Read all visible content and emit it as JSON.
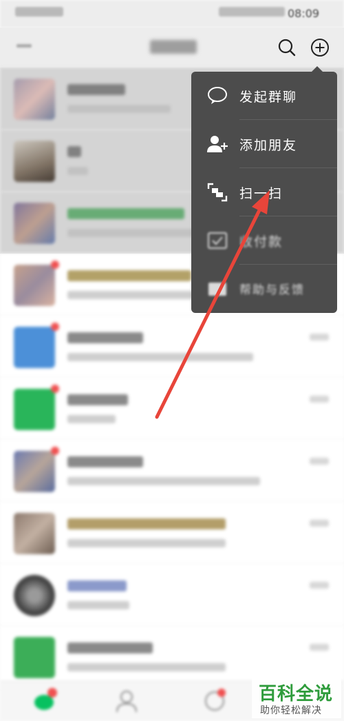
{
  "status_bar": {
    "time": "08:09"
  },
  "popup_menu": {
    "items": [
      {
        "label": "发起群聊",
        "icon": "chat-bubble-icon"
      },
      {
        "label": "添加朋友",
        "icon": "add-friend-icon"
      },
      {
        "label": "扫一扫",
        "icon": "scan-icon"
      },
      {
        "label": "收付款",
        "icon": "payment-icon"
      },
      {
        "label": "帮助与反馈",
        "icon": "help-feedback-icon"
      }
    ]
  },
  "watermark": {
    "title": "百科全说",
    "subtitle": "助你轻松解决"
  },
  "colors": {
    "popup_bg": "#4c4c4c",
    "annotation_arrow": "#e8453a",
    "wechat_green": "#07c160",
    "watermark_green": "#2f9c3c"
  }
}
